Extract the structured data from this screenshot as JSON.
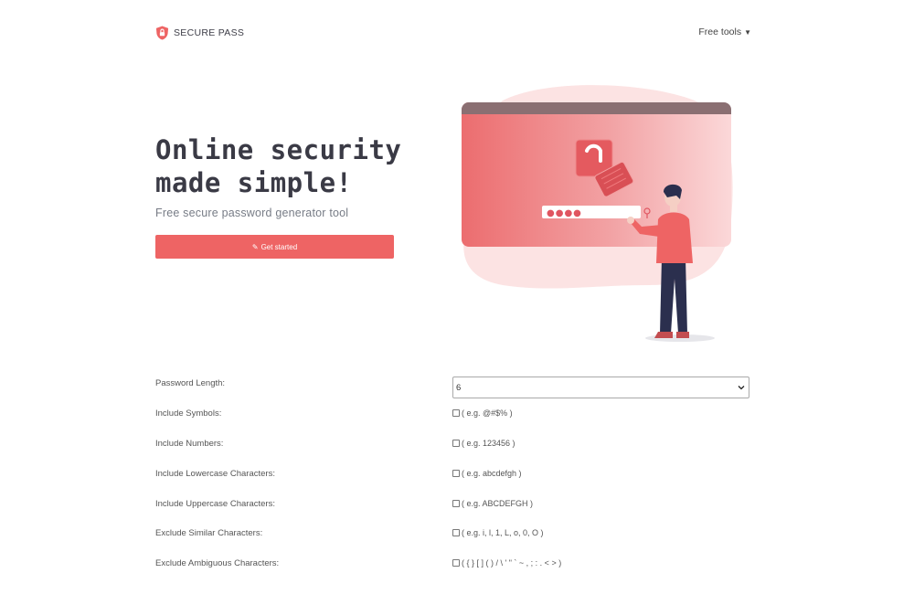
{
  "brand": {
    "name": "SECURE PASS",
    "icon": "shield-lock-icon",
    "color": "#ee6464"
  },
  "nav": {
    "free_tools_label": "Free tools"
  },
  "hero": {
    "title": "Online security\nmade simple!",
    "subtitle": "Free secure password generator tool",
    "cta_label": "Get started",
    "cta_icon": "tag-icon",
    "cta_color": "#ee6464"
  },
  "illustration": {
    "password_dots": "●●●●"
  },
  "form": {
    "length": {
      "label": "Password Length:",
      "value": "6"
    },
    "symbols": {
      "label": "Include Symbols:",
      "hint": "( e.g. @#$% )"
    },
    "numbers": {
      "label": "Include Numbers:",
      "hint": "( e.g. 123456 )"
    },
    "lowercase": {
      "label": "Include Lowercase Characters:",
      "hint": "( e.g. abcdefgh )"
    },
    "uppercase": {
      "label": "Include Uppercase Characters:",
      "hint": "( e.g. ABCDEFGH )"
    },
    "similar": {
      "label": "Exclude Similar Characters:",
      "hint": "( e.g. i, l, 1, L, o, 0, O )"
    },
    "ambiguous": {
      "label": "Exclude Ambiguous Characters:",
      "hint": "( { } [ ] ( ) / \\ ' \" ` ~ , ; : . < > )"
    }
  }
}
